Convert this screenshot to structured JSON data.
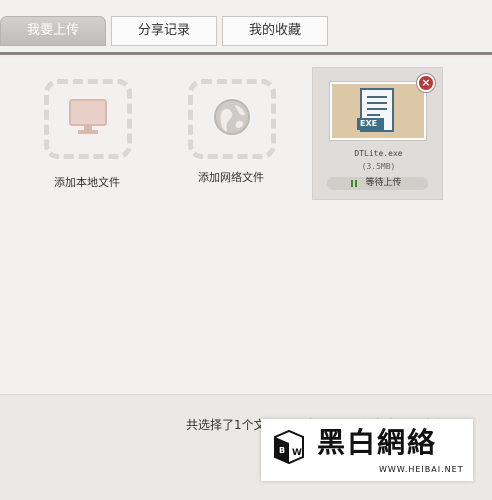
{
  "tabs": [
    {
      "label": "我要上传",
      "active": true
    },
    {
      "label": "分享记录",
      "active": false
    },
    {
      "label": "我的收藏",
      "active": false
    }
  ],
  "main": {
    "add_local_label": "添加本地文件",
    "add_network_label": "添加网络文件",
    "file": {
      "name": "DTLite.exe",
      "size": "(3.5MB)",
      "type_badge": "EXE",
      "status": "等待上传"
    }
  },
  "footer": {
    "summary": "共选择了1个文... 所需空间 ... 进行完成后，请点"
  },
  "watermark": {
    "brand": "黑白網絡",
    "url": "WWW.HEIBAI.NET"
  },
  "colors": {
    "accent_red": "#b73a3a",
    "status_green": "#3f8a2f",
    "tab_active_bg": "#c6c3c0",
    "divider": "#8b8180"
  }
}
